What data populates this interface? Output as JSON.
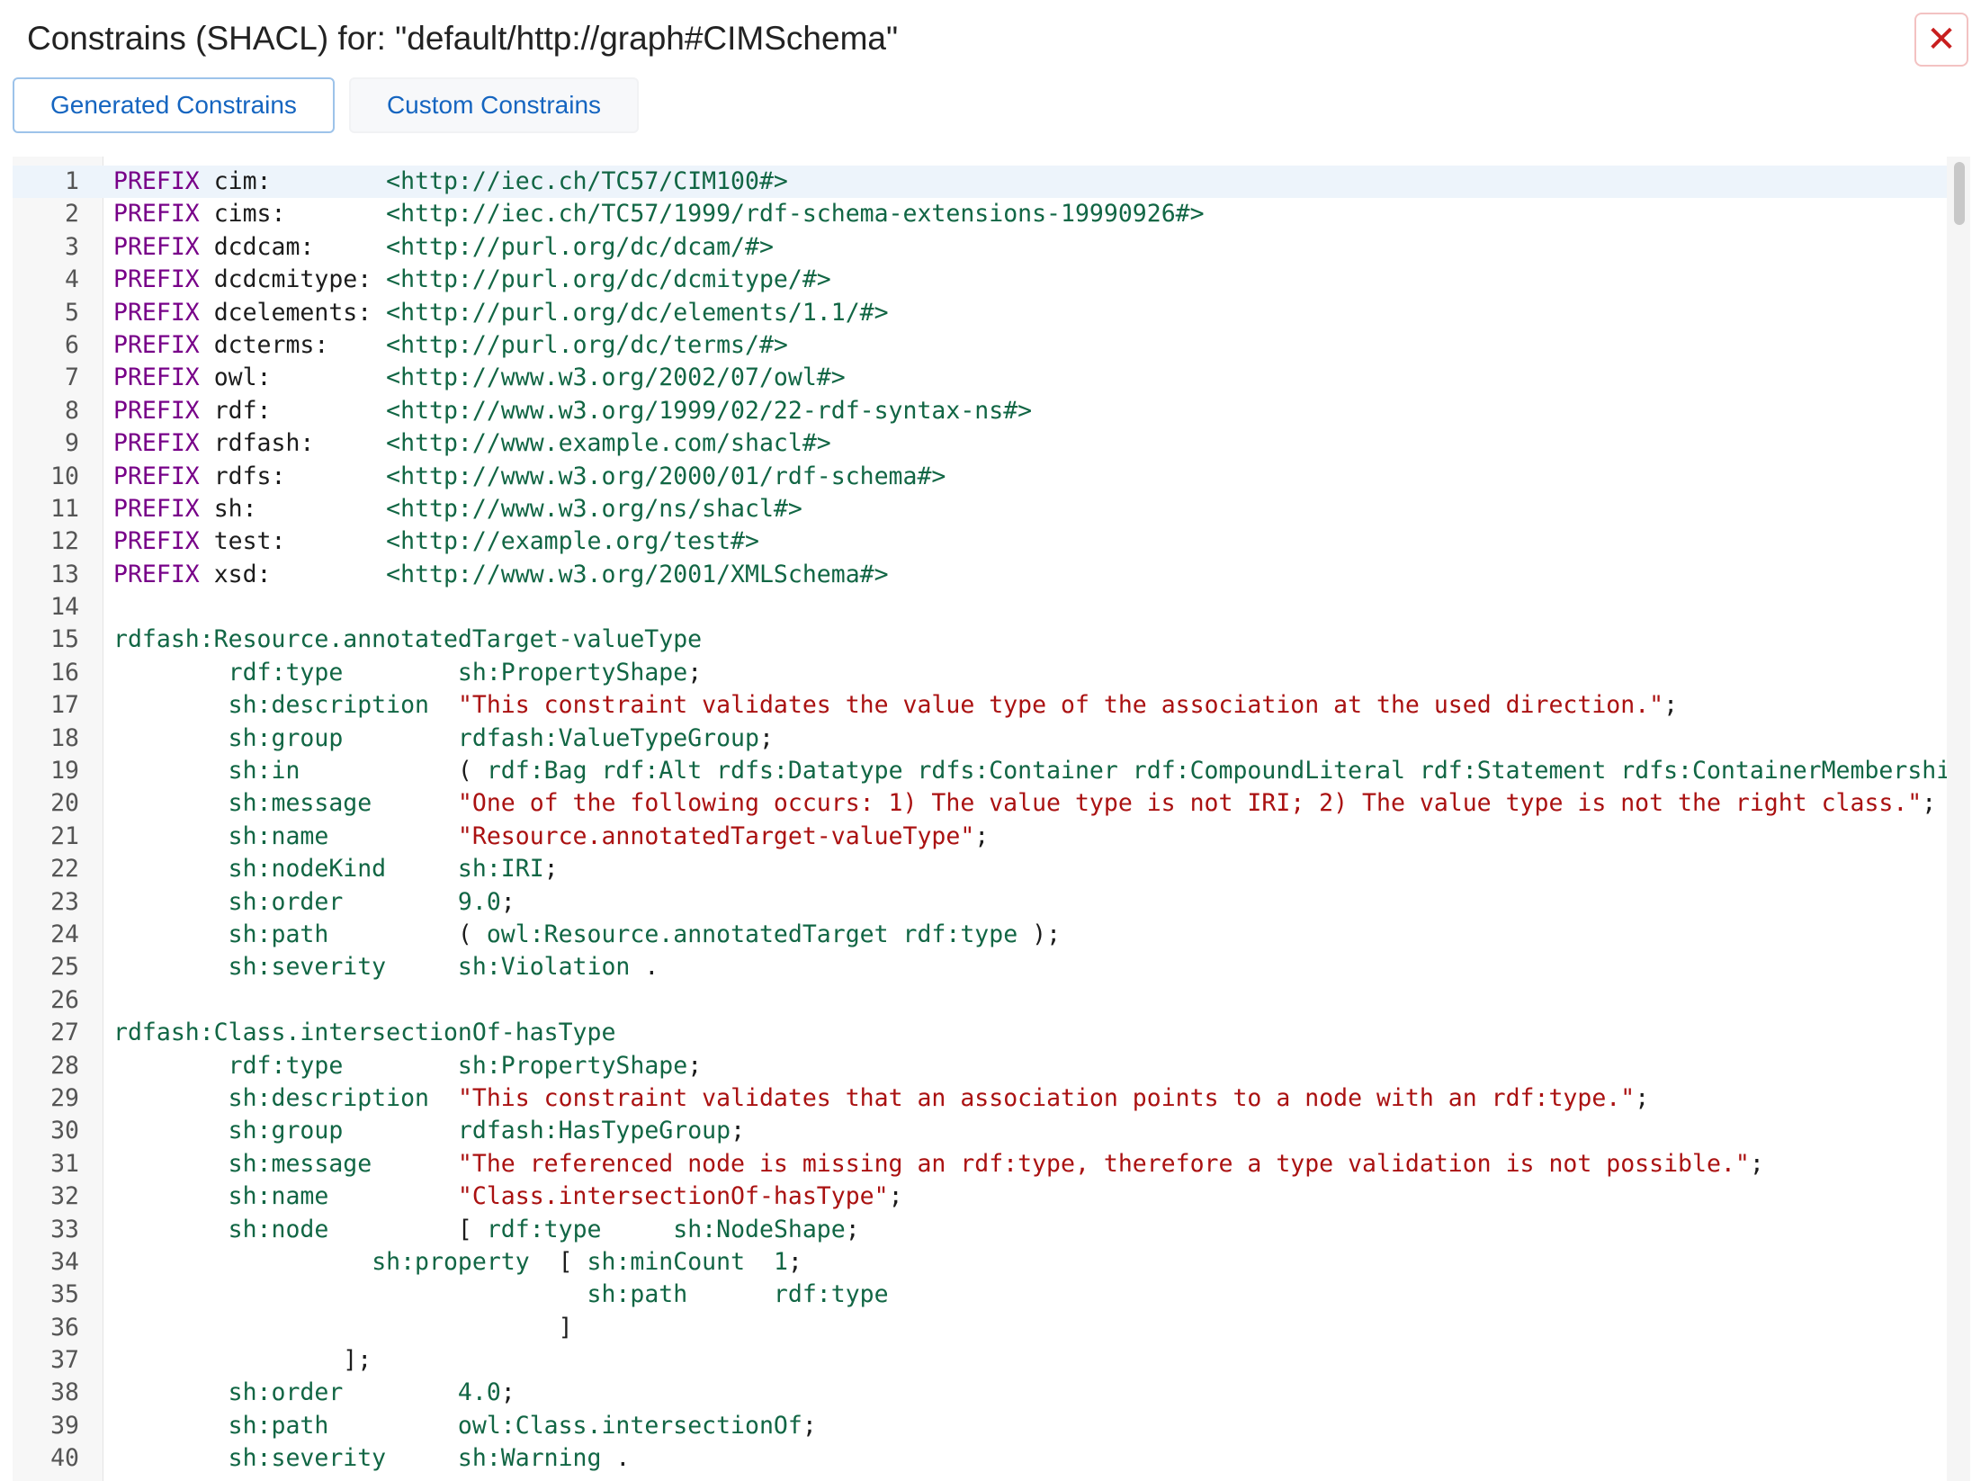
{
  "dialog": {
    "title": "Constrains (SHACL) for: \"default/http://graph#CIMSchema\"",
    "close_label": "✕"
  },
  "tabs": [
    {
      "label": "Generated Constrains",
      "active": true
    },
    {
      "label": "Custom Constrains",
      "active": false
    }
  ],
  "editor": {
    "lines": [
      [
        [
          "kw",
          "PREFIX"
        ],
        [
          "tx",
          " cim:        "
        ],
        [
          "def",
          "<http://iec.ch/TC57/CIM100#>"
        ]
      ],
      [
        [
          "kw",
          "PREFIX"
        ],
        [
          "tx",
          " cims:       "
        ],
        [
          "def",
          "<http://iec.ch/TC57/1999/rdf-schema-extensions-19990926#>"
        ]
      ],
      [
        [
          "kw",
          "PREFIX"
        ],
        [
          "tx",
          " dcdcam:     "
        ],
        [
          "def",
          "<http://purl.org/dc/dcam/#>"
        ]
      ],
      [
        [
          "kw",
          "PREFIX"
        ],
        [
          "tx",
          " dcdcmitype: "
        ],
        [
          "def",
          "<http://purl.org/dc/dcmitype/#>"
        ]
      ],
      [
        [
          "kw",
          "PREFIX"
        ],
        [
          "tx",
          " dcelements: "
        ],
        [
          "def",
          "<http://purl.org/dc/elements/1.1/#>"
        ]
      ],
      [
        [
          "kw",
          "PREFIX"
        ],
        [
          "tx",
          " dcterms:    "
        ],
        [
          "def",
          "<http://purl.org/dc/terms/#>"
        ]
      ],
      [
        [
          "kw",
          "PREFIX"
        ],
        [
          "tx",
          " owl:        "
        ],
        [
          "def",
          "<http://www.w3.org/2002/07/owl#>"
        ]
      ],
      [
        [
          "kw",
          "PREFIX"
        ],
        [
          "tx",
          " rdf:        "
        ],
        [
          "def",
          "<http://www.w3.org/1999/02/22-rdf-syntax-ns#>"
        ]
      ],
      [
        [
          "kw",
          "PREFIX"
        ],
        [
          "tx",
          " rdfash:     "
        ],
        [
          "def",
          "<http://www.example.com/shacl#>"
        ]
      ],
      [
        [
          "kw",
          "PREFIX"
        ],
        [
          "tx",
          " rdfs:       "
        ],
        [
          "def",
          "<http://www.w3.org/2000/01/rdf-schema#>"
        ]
      ],
      [
        [
          "kw",
          "PREFIX"
        ],
        [
          "tx",
          " sh:         "
        ],
        [
          "def",
          "<http://www.w3.org/ns/shacl#>"
        ]
      ],
      [
        [
          "kw",
          "PREFIX"
        ],
        [
          "tx",
          " test:       "
        ],
        [
          "def",
          "<http://example.org/test#>"
        ]
      ],
      [
        [
          "kw",
          "PREFIX"
        ],
        [
          "tx",
          " xsd:        "
        ],
        [
          "def",
          "<http://www.w3.org/2001/XMLSchema#>"
        ]
      ],
      [],
      [
        [
          "def",
          "rdfash:Resource.annotatedTarget-valueType"
        ]
      ],
      [
        [
          "tx",
          "        "
        ],
        [
          "def",
          "rdf:type"
        ],
        [
          "tx",
          "        "
        ],
        [
          "def",
          "sh:PropertyShape"
        ],
        [
          "pn",
          ";"
        ]
      ],
      [
        [
          "tx",
          "        "
        ],
        [
          "def",
          "sh:description"
        ],
        [
          "tx",
          "  "
        ],
        [
          "str",
          "\"This constraint validates the value type of the association at the used direction.\""
        ],
        [
          "pn",
          ";"
        ]
      ],
      [
        [
          "tx",
          "        "
        ],
        [
          "def",
          "sh:group"
        ],
        [
          "tx",
          "        "
        ],
        [
          "def",
          "rdfash:ValueTypeGroup"
        ],
        [
          "pn",
          ";"
        ]
      ],
      [
        [
          "tx",
          "        "
        ],
        [
          "def",
          "sh:in"
        ],
        [
          "tx",
          "           "
        ],
        [
          "pn",
          "( "
        ],
        [
          "def",
          "rdf:Bag rdf:Alt rdfs:Datatype rdfs:Container rdf:CompoundLiteral rdf:Statement rdfs:ContainerMembershipProperty"
        ]
      ],
      [
        [
          "tx",
          "        "
        ],
        [
          "def",
          "sh:message"
        ],
        [
          "tx",
          "      "
        ],
        [
          "str",
          "\"One of the following occurs: 1) The value type is not IRI; 2) The value type is not the right class.\""
        ],
        [
          "pn",
          ";"
        ]
      ],
      [
        [
          "tx",
          "        "
        ],
        [
          "def",
          "sh:name"
        ],
        [
          "tx",
          "         "
        ],
        [
          "str",
          "\"Resource.annotatedTarget-valueType\""
        ],
        [
          "pn",
          ";"
        ]
      ],
      [
        [
          "tx",
          "        "
        ],
        [
          "def",
          "sh:nodeKind"
        ],
        [
          "tx",
          "     "
        ],
        [
          "def",
          "sh:IRI"
        ],
        [
          "pn",
          ";"
        ]
      ],
      [
        [
          "tx",
          "        "
        ],
        [
          "def",
          "sh:order"
        ],
        [
          "tx",
          "        "
        ],
        [
          "num",
          "9.0"
        ],
        [
          "pn",
          ";"
        ]
      ],
      [
        [
          "tx",
          "        "
        ],
        [
          "def",
          "sh:path"
        ],
        [
          "tx",
          "         "
        ],
        [
          "pn",
          "( "
        ],
        [
          "def",
          "owl:Resource.annotatedTarget rdf:type"
        ],
        [
          "pn",
          " );"
        ]
      ],
      [
        [
          "tx",
          "        "
        ],
        [
          "def",
          "sh:severity"
        ],
        [
          "tx",
          "     "
        ],
        [
          "def",
          "sh:Violation"
        ],
        [
          "pn",
          " ."
        ]
      ],
      [],
      [
        [
          "def",
          "rdfash:Class.intersectionOf-hasType"
        ]
      ],
      [
        [
          "tx",
          "        "
        ],
        [
          "def",
          "rdf:type"
        ],
        [
          "tx",
          "        "
        ],
        [
          "def",
          "sh:PropertyShape"
        ],
        [
          "pn",
          ";"
        ]
      ],
      [
        [
          "tx",
          "        "
        ],
        [
          "def",
          "sh:description"
        ],
        [
          "tx",
          "  "
        ],
        [
          "str",
          "\"This constraint validates that an association points to a node with an rdf:type.\""
        ],
        [
          "pn",
          ";"
        ]
      ],
      [
        [
          "tx",
          "        "
        ],
        [
          "def",
          "sh:group"
        ],
        [
          "tx",
          "        "
        ],
        [
          "def",
          "rdfash:HasTypeGroup"
        ],
        [
          "pn",
          ";"
        ]
      ],
      [
        [
          "tx",
          "        "
        ],
        [
          "def",
          "sh:message"
        ],
        [
          "tx",
          "      "
        ],
        [
          "str",
          "\"The referenced node is missing an rdf:type, therefore a type validation is not possible.\""
        ],
        [
          "pn",
          ";"
        ]
      ],
      [
        [
          "tx",
          "        "
        ],
        [
          "def",
          "sh:name"
        ],
        [
          "tx",
          "         "
        ],
        [
          "str",
          "\"Class.intersectionOf-hasType\""
        ],
        [
          "pn",
          ";"
        ]
      ],
      [
        [
          "tx",
          "        "
        ],
        [
          "def",
          "sh:node"
        ],
        [
          "tx",
          "         "
        ],
        [
          "pn",
          "[ "
        ],
        [
          "def",
          "rdf:type"
        ],
        [
          "tx",
          "     "
        ],
        [
          "def",
          "sh:NodeShape"
        ],
        [
          "pn",
          ";"
        ]
      ],
      [
        [
          "tx",
          "                  "
        ],
        [
          "def",
          "sh:property"
        ],
        [
          "tx",
          "  "
        ],
        [
          "pn",
          "[ "
        ],
        [
          "def",
          "sh:minCount"
        ],
        [
          "tx",
          "  "
        ],
        [
          "num",
          "1"
        ],
        [
          "pn",
          ";"
        ]
      ],
      [
        [
          "tx",
          "                                 "
        ],
        [
          "def",
          "sh:path"
        ],
        [
          "tx",
          "      "
        ],
        [
          "def",
          "rdf:type"
        ]
      ],
      [
        [
          "tx",
          "                               "
        ],
        [
          "pn",
          "]"
        ]
      ],
      [
        [
          "tx",
          "                "
        ],
        [
          "pn",
          "];"
        ]
      ],
      [
        [
          "tx",
          "        "
        ],
        [
          "def",
          "sh:order"
        ],
        [
          "tx",
          "        "
        ],
        [
          "num",
          "4.0"
        ],
        [
          "pn",
          ";"
        ]
      ],
      [
        [
          "tx",
          "        "
        ],
        [
          "def",
          "sh:path"
        ],
        [
          "tx",
          "         "
        ],
        [
          "def",
          "owl:Class.intersectionOf"
        ],
        [
          "pn",
          ";"
        ]
      ],
      [
        [
          "tx",
          "        "
        ],
        [
          "def",
          "sh:severity"
        ],
        [
          "tx",
          "     "
        ],
        [
          "def",
          "sh:Warning"
        ],
        [
          "pn",
          " ."
        ]
      ]
    ]
  }
}
